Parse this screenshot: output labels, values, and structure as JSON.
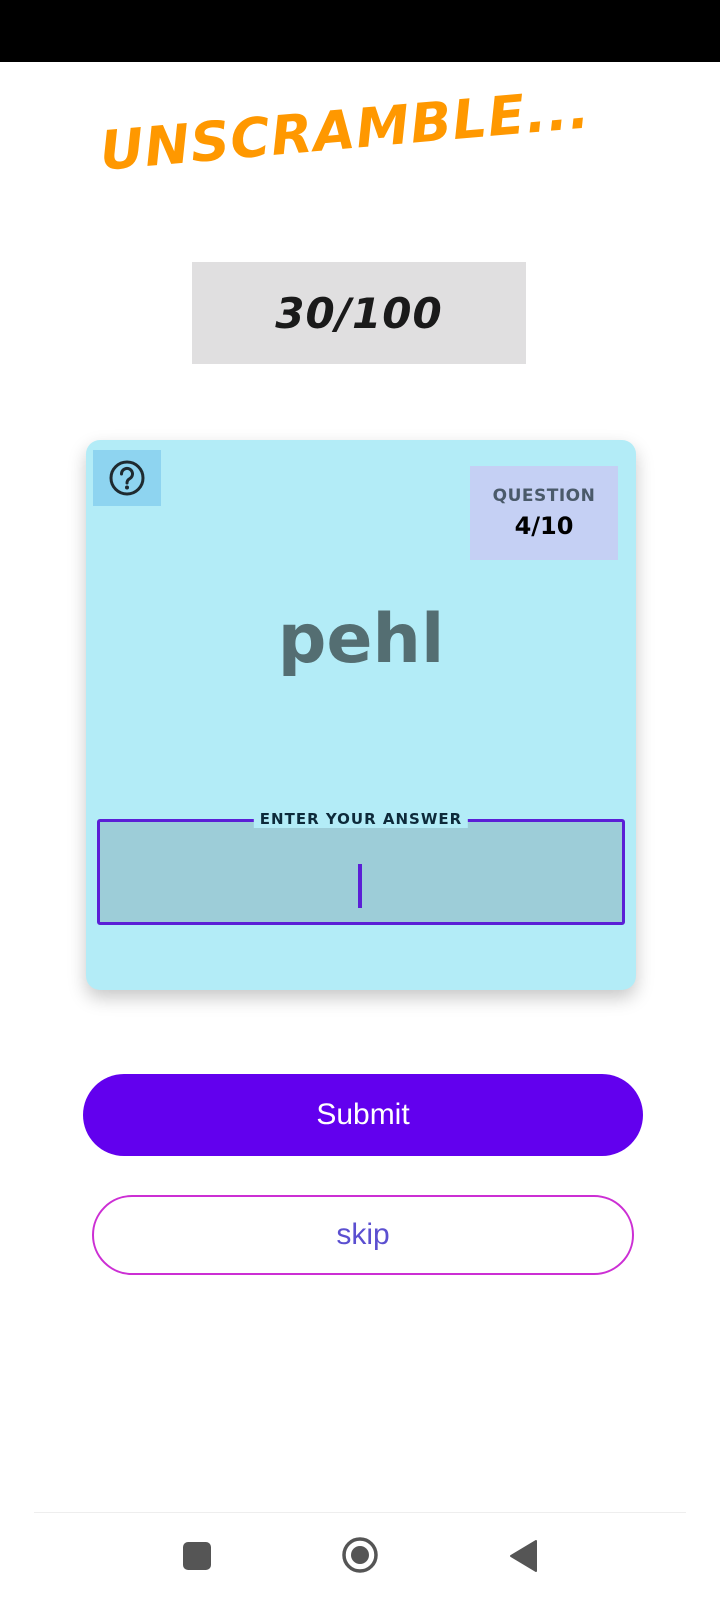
{
  "header": {
    "title": "UNSCRAMBLE..."
  },
  "score": {
    "text": "30/100"
  },
  "card": {
    "help_icon": "help-circle-icon",
    "question_label": "QUESTION",
    "question_count": "4/10",
    "scrambled_word": "pehl",
    "answer_label": "ENTER YOUR ANSWER",
    "answer_value": ""
  },
  "actions": {
    "submit_label": "Submit",
    "skip_label": "skip"
  },
  "nav": {
    "recents_icon": "square-icon",
    "home_icon": "circle-icon",
    "back_icon": "triangle-back-icon"
  },
  "colors": {
    "title": "#ff9800",
    "card_background": "#b3ecf7",
    "primary": "#6200ee",
    "skip_border": "#cc2fd4"
  }
}
